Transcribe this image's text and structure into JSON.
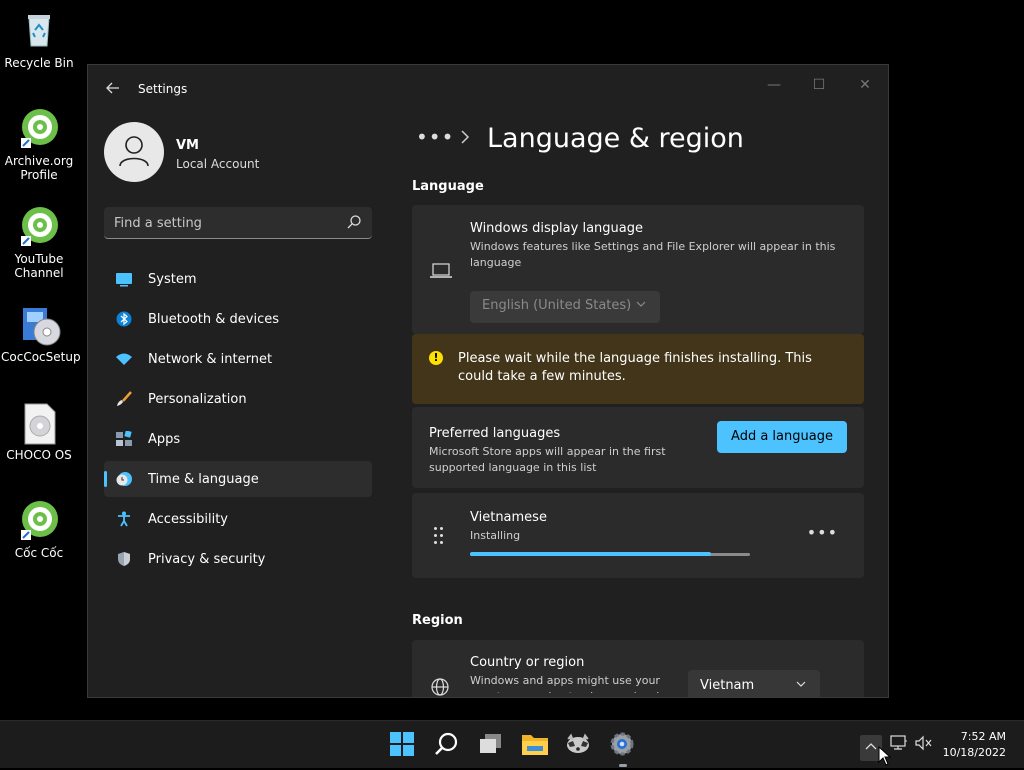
{
  "desktop": {
    "icons": [
      {
        "label": "Recycle Bin"
      },
      {
        "label": "Archive.org Profile"
      },
      {
        "label": "YouTube Channel"
      },
      {
        "label": "CocCocSetup"
      },
      {
        "label": "CHOCO OS"
      },
      {
        "label": "Cốc Cốc"
      }
    ]
  },
  "window": {
    "title": "Settings",
    "controls": {
      "minimize": "—",
      "maximize": "☐",
      "close": "✕"
    }
  },
  "user": {
    "name": "VM",
    "type": "Local Account"
  },
  "search": {
    "placeholder": "Find a setting"
  },
  "nav": {
    "items": [
      {
        "label": "System",
        "icon": "system-icon"
      },
      {
        "label": "Bluetooth & devices",
        "icon": "bluetooth-icon"
      },
      {
        "label": "Network & internet",
        "icon": "network-icon"
      },
      {
        "label": "Personalization",
        "icon": "brush-icon"
      },
      {
        "label": "Apps",
        "icon": "apps-icon"
      },
      {
        "label": "Time & language",
        "icon": "time-language-icon",
        "active": true
      },
      {
        "label": "Accessibility",
        "icon": "accessibility-icon"
      },
      {
        "label": "Privacy & security",
        "icon": "shield-icon"
      }
    ]
  },
  "page": {
    "breadcrumb_more": "•••",
    "title": "Language & region"
  },
  "language": {
    "section": "Language",
    "display": {
      "title": "Windows display language",
      "desc": "Windows features like Settings and File Explorer will appear in this language",
      "value": "English (United States)"
    },
    "warning": "Please wait while the language finishes installing. This could take a few minutes.",
    "preferred": {
      "title": "Preferred languages",
      "desc": "Microsoft Store apps will appear in the first supported language in this list",
      "add_label": "Add a language"
    },
    "entry": {
      "name": "Vietnamese",
      "status": "Installing",
      "progress": 0.86,
      "more": "•••"
    }
  },
  "region": {
    "section": "Region",
    "country": {
      "title": "Country or region",
      "desc": "Windows and apps might use your country or region to give you local",
      "value": "Vietnam"
    }
  },
  "taskbar": {
    "time": "7:52 AM",
    "date": "10/18/2022"
  },
  "colors": {
    "accent": "#4cc2ff",
    "warning_bg": "#433519",
    "warning_icon": "#fce100"
  }
}
